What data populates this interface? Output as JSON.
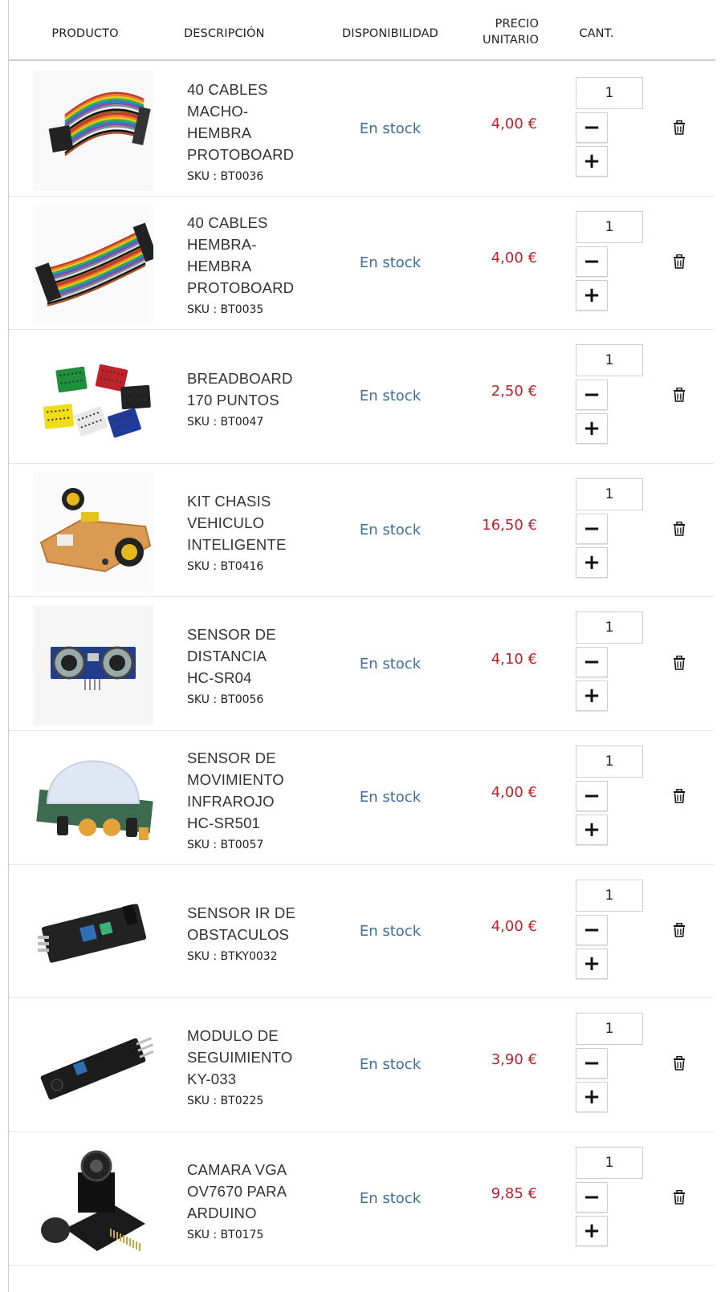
{
  "header": {
    "product": "PRODUCTO",
    "description": "DESCRIPCIÓN",
    "availability": "DISPONIBILIDAD",
    "price_line1": "PRECIO",
    "price_line2": "UNITARIO",
    "quantity": "CANT."
  },
  "colors": {
    "availability": "#3b6e9e",
    "price": "#b8222b"
  },
  "items": [
    {
      "name": "40 CABLES MACHO-HEMBRA PROTOBOARD",
      "name_lines": [
        "40 CABLES",
        "MACHO-",
        "HEMBRA",
        "PROTOBOARD"
      ],
      "sku": "SKU : BT0036",
      "availability": "En stock",
      "price": "4,00 €",
      "quantity": "1",
      "image": "ribbon-cable-male-female"
    },
    {
      "name": "40 CABLES HEMBRA-HEMBRA PROTOBOARD",
      "name_lines": [
        "40 CABLES",
        "HEMBRA-",
        "HEMBRA",
        "PROTOBOARD"
      ],
      "sku": "SKU : BT0035",
      "availability": "En stock",
      "price": "4,00 €",
      "quantity": "1",
      "image": "ribbon-cable-female-female"
    },
    {
      "name": "BREADBOARD 170 PUNTOS",
      "name_lines": [
        "BREADBOARD",
        "170 PUNTOS"
      ],
      "sku": "SKU : BT0047",
      "availability": "En stock",
      "price": "2,50 €",
      "quantity": "1",
      "image": "mini-breadboards"
    },
    {
      "name": "KIT CHASIS VEHICULO INTELIGENTE",
      "name_lines": [
        "KIT CHASIS",
        "VEHICULO",
        "INTELIGENTE"
      ],
      "sku": "SKU : BT0416",
      "availability": "En stock",
      "price": "16,50 €",
      "quantity": "1",
      "image": "robot-car-chassis"
    },
    {
      "name": "SENSOR DE DISTANCIA HC-SR04",
      "name_lines": [
        "SENSOR DE",
        "DISTANCIA",
        "HC-SR04"
      ],
      "sku": "SKU : BT0056",
      "availability": "En stock",
      "price": "4,10 €",
      "quantity": "1",
      "image": "ultrasonic-sensor"
    },
    {
      "name": "SENSOR DE MOVIMIENTO INFRAROJO HC-SR501",
      "name_lines": [
        "SENSOR DE",
        "MOVIMIENTO",
        "INFRAROJO",
        "HC-SR501"
      ],
      "sku": "SKU : BT0057",
      "availability": "En stock",
      "price": "4,00 €",
      "quantity": "1",
      "image": "pir-sensor"
    },
    {
      "name": "SENSOR IR DE OBSTACULOS",
      "name_lines": [
        "SENSOR IR DE",
        "OBSTACULOS"
      ],
      "sku": "SKU : BTKY0032",
      "availability": "En stock",
      "price": "4,00 €",
      "quantity": "1",
      "image": "ir-obstacle-sensor"
    },
    {
      "name": "MODULO DE SEGUIMIENTO KY-033",
      "name_lines": [
        "MODULO DE",
        "SEGUIMIENTO",
        "KY-033"
      ],
      "sku": "SKU : BT0225",
      "availability": "En stock",
      "price": "3,90 €",
      "quantity": "1",
      "image": "line-tracking-module"
    },
    {
      "name": "CAMARA VGA OV7670 PARA ARDUINO",
      "name_lines": [
        "CAMARA VGA",
        "OV7670 PARA",
        "ARDUINO"
      ],
      "sku": "SKU : BT0175",
      "availability": "En stock",
      "price": "9,85 €",
      "quantity": "1",
      "image": "camera-module"
    }
  ],
  "icons": {
    "minus": "−",
    "plus": "+",
    "delete": "trash-icon"
  }
}
